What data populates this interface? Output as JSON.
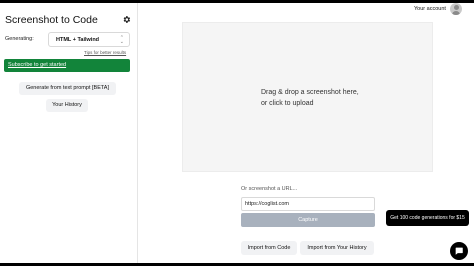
{
  "app": {
    "title": "Screenshot to Code"
  },
  "sidebar": {
    "generating_label": "Generating:",
    "stack_value": "HTML + Tailwind",
    "tips_link": "Tips for better results",
    "subscribe_label": "Subscribe to get started",
    "text_prompt_button": "Generate from text prompt [BETA]",
    "history_button": "Your History"
  },
  "header": {
    "account_label": "Your account"
  },
  "dropzone": {
    "line1": "Drag & drop a screenshot here,",
    "line2": "or click to upload"
  },
  "url_section": {
    "label": "Or screenshot a URL...",
    "input_value": "https://coglist.com",
    "capture_button": "Capture"
  },
  "import": {
    "from_code": "Import from Code",
    "from_history": "Import from Your History"
  },
  "promo": {
    "label": "Get 100 code generations for $15"
  },
  "icons": {
    "settings": "gear-icon",
    "select_arrow": "chevron-updown-icon",
    "avatar": "user-avatar",
    "chat": "chat-bubble-icon"
  },
  "colors": {
    "subscribe_bg": "#12843a",
    "capture_bg": "#a8b1bd",
    "dropzone_bg": "#f5f5f5",
    "promo_bg": "#000000"
  }
}
